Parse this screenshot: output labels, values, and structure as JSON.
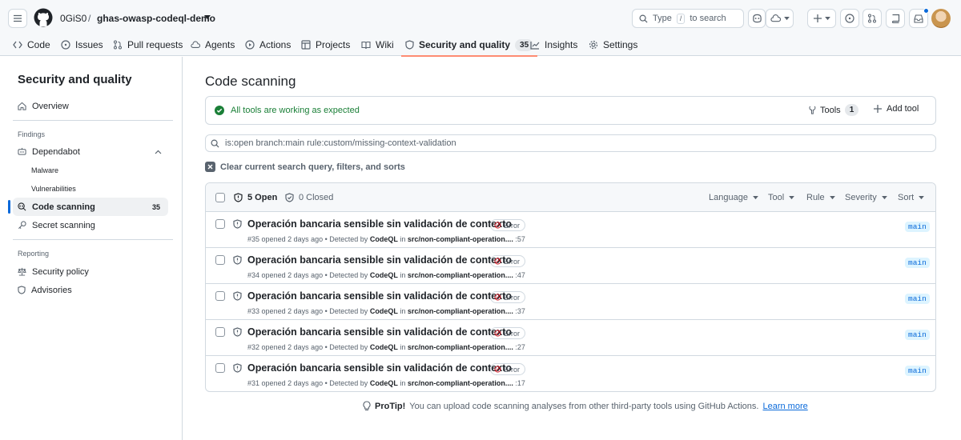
{
  "header": {
    "owner": "0GiS0",
    "separator": "/",
    "repo": "ghas-owasp-codeql-demo",
    "search_prefix": "Type",
    "search_key": "/",
    "search_suffix": "to search"
  },
  "nav": {
    "code": "Code",
    "issues": "Issues",
    "pulls": "Pull requests",
    "agents": "Agents",
    "actions": "Actions",
    "projects": "Projects",
    "wiki": "Wiki",
    "security": "Security and quality",
    "security_count": "35",
    "insights": "Insights",
    "settings": "Settings"
  },
  "sidebar": {
    "title": "Security and quality",
    "overview": "Overview",
    "findings_head": "Findings",
    "dependabot": "Dependabot",
    "malware": "Malware",
    "vulnerabilities": "Vulnerabilities",
    "code_scanning": "Code scanning",
    "code_scanning_count": "35",
    "secret_scanning": "Secret scanning",
    "reporting_head": "Reporting",
    "security_policy": "Security policy",
    "advisories": "Advisories"
  },
  "main": {
    "title": "Code scanning",
    "status": "All tools are working as expected",
    "tools_label": "Tools",
    "tools_count": "1",
    "add_tool": "Add tool",
    "query": "is:open branch:main rule:custom/missing-context-validation",
    "clear": "Clear current search query, filters, and sorts",
    "open": "5 Open",
    "closed": "0 Closed",
    "filters": {
      "language": "Language",
      "tool": "Tool",
      "rule": "Rule",
      "severity": "Severity",
      "sort": "Sort"
    }
  },
  "alerts": [
    {
      "title": "Operación bancaria sensible sin validación de contexto",
      "severity": "Error",
      "number": "#35",
      "opened": "opened 2 days ago",
      "detected_by": "Detected by",
      "tool": "CodeQL",
      "in": "in",
      "file": "src/non-compliant-operation....",
      "line": ":57",
      "branch": "main"
    },
    {
      "title": "Operación bancaria sensible sin validación de contexto",
      "severity": "Error",
      "number": "#34",
      "opened": "opened 2 days ago",
      "detected_by": "Detected by",
      "tool": "CodeQL",
      "in": "in",
      "file": "src/non-compliant-operation....",
      "line": ":47",
      "branch": "main"
    },
    {
      "title": "Operación bancaria sensible sin validación de contexto",
      "severity": "Error",
      "number": "#33",
      "opened": "opened 2 days ago",
      "detected_by": "Detected by",
      "tool": "CodeQL",
      "in": "in",
      "file": "src/non-compliant-operation....",
      "line": ":37",
      "branch": "main"
    },
    {
      "title": "Operación bancaria sensible sin validación de contexto",
      "severity": "Error",
      "number": "#32",
      "opened": "opened 2 days ago",
      "detected_by": "Detected by",
      "tool": "CodeQL",
      "in": "in",
      "file": "src/non-compliant-operation....",
      "line": ":27",
      "branch": "main"
    },
    {
      "title": "Operación bancaria sensible sin validación de contexto",
      "severity": "Error",
      "number": "#31",
      "opened": "opened 2 days ago",
      "detected_by": "Detected by",
      "tool": "CodeQL",
      "in": "in",
      "file": "src/non-compliant-operation....",
      "line": ":17",
      "branch": "main"
    }
  ],
  "protip": {
    "label": "ProTip!",
    "text": "You can upload code scanning analyses from other third-party tools using GitHub Actions.",
    "link": "Learn more"
  },
  "colors": {
    "accent": "#0969da",
    "success": "#1a7f37",
    "danger": "#cf222e",
    "underline": "#fd8c73"
  }
}
